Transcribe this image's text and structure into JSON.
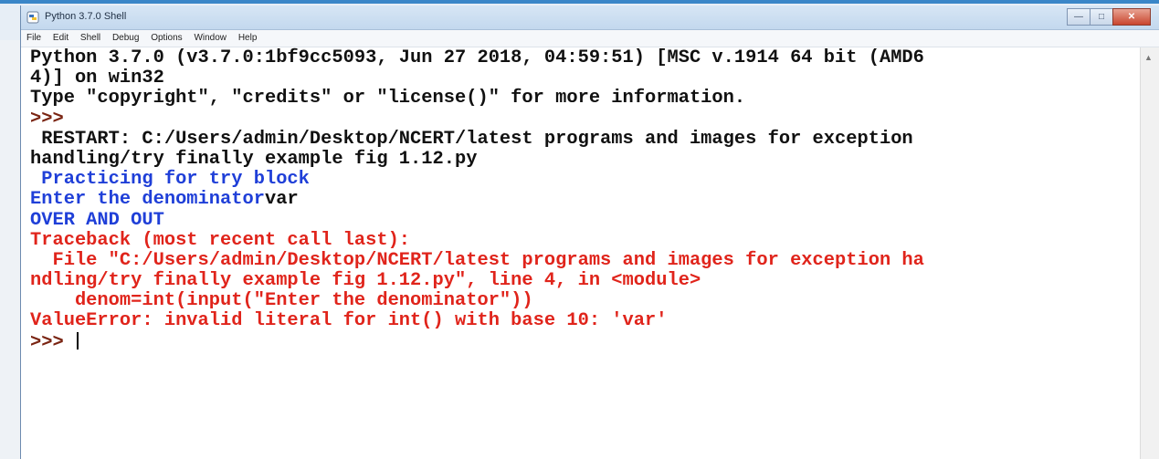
{
  "window": {
    "title": "Python 3.7.0 Shell"
  },
  "menu": [
    "File",
    "Edit",
    "Shell",
    "Debug",
    "Options",
    "Window",
    "Help"
  ],
  "shell": {
    "lines": [
      {
        "text": "Python 3.7.0 (v3.7.0:1bf9cc5093, Jun 27 2018, 04:59:51) [MSC v.1914 64 bit (AMD6",
        "color": "black"
      },
      {
        "text": "4)] on win32",
        "color": "black"
      },
      {
        "text": "Type \"copyright\", \"credits\" or \"license()\" for more information.",
        "color": "black"
      },
      {
        "text": ">>>",
        "color": "prompt"
      },
      {
        "text": " RESTART: C:/Users/admin/Desktop/NCERT/latest programs and images for exception",
        "color": "black"
      },
      {
        "text": "handling/try finally example fig 1.12.py",
        "color": "black"
      },
      {
        "text": " Practicing for try block",
        "color": "blue"
      },
      {
        "text": "Enter the denominator",
        "color": "blue",
        "suffix": "var",
        "suffix_color": "black"
      },
      {
        "text": "OVER AND OUT",
        "color": "blue"
      },
      {
        "text": "Traceback (most recent call last):",
        "color": "red"
      },
      {
        "text": "  File \"C:/Users/admin/Desktop/NCERT/latest programs and images for exception ha",
        "color": "red"
      },
      {
        "text": "ndling/try finally example fig 1.12.py\", line 4, in <module>",
        "color": "red"
      },
      {
        "text": "    denom=int(input(\"Enter the denominator\"))",
        "color": "red"
      },
      {
        "text": "ValueError: invalid literal for int() with base 10: 'var'",
        "color": "red"
      },
      {
        "text": ">>> ",
        "color": "prompt",
        "cursor": true
      }
    ]
  },
  "colors": {
    "output": "#1f3fd8",
    "error": "#e0241b",
    "prompt": "#7a2412",
    "text": "#111111"
  },
  "icons": {
    "app": "python-idle-icon",
    "minimize": "minimize-icon",
    "maximize": "maximize-icon",
    "close": "close-icon"
  }
}
